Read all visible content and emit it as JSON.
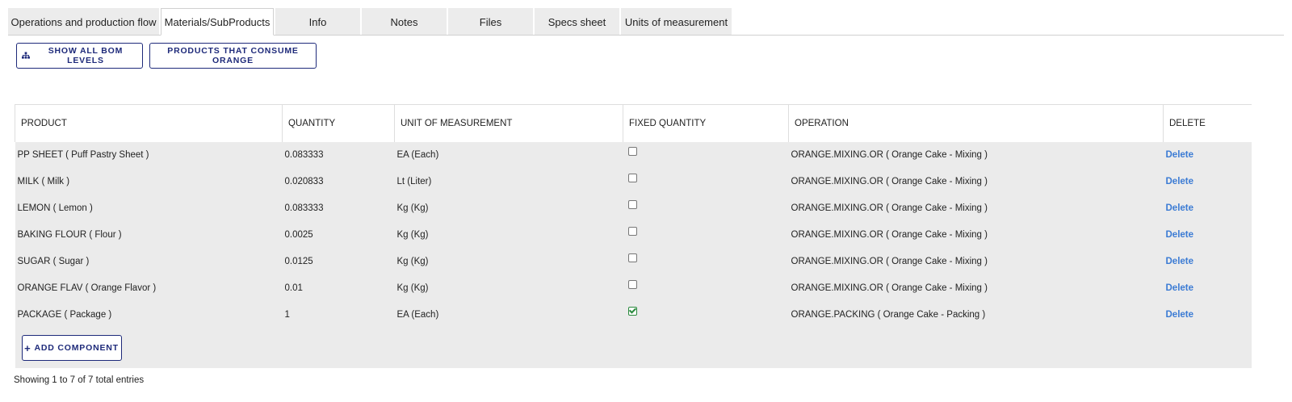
{
  "tabs": [
    {
      "label": "Operations and production flow",
      "active": false
    },
    {
      "label": "Materials/SubProducts",
      "active": true
    },
    {
      "label": "Info",
      "active": false
    },
    {
      "label": "Notes",
      "active": false
    },
    {
      "label": "Files",
      "active": false
    },
    {
      "label": "Specs sheet",
      "active": false
    },
    {
      "label": "Units of measurement",
      "active": false
    }
  ],
  "toolbar": {
    "show_bom_label": "SHOW ALL BOM LEVELS",
    "show_bom_icon": "sitemap-icon",
    "consumers_label": "PRODUCTS THAT CONSUME ORANGE"
  },
  "table": {
    "columns": [
      "PRODUCT",
      "QUANTITY",
      "UNIT OF MEASUREMENT",
      "FIXED QUANTITY",
      "OPERATION",
      "DELETE"
    ],
    "rows": [
      {
        "product": "PP SHEET ( Puff Pastry Sheet )",
        "quantity": "0.083333",
        "unit": "EA (Each)",
        "fixed": false,
        "operation": "ORANGE.MIXING.OR ( Orange Cake - Mixing )",
        "delete": "Delete"
      },
      {
        "product": "MILK ( Milk )",
        "quantity": "0.020833",
        "unit": "Lt (Liter)",
        "fixed": false,
        "operation": "ORANGE.MIXING.OR ( Orange Cake - Mixing )",
        "delete": "Delete"
      },
      {
        "product": "LEMON ( Lemon )",
        "quantity": "0.083333",
        "unit": "Kg (Kg)",
        "fixed": false,
        "operation": "ORANGE.MIXING.OR ( Orange Cake - Mixing )",
        "delete": "Delete"
      },
      {
        "product": "BAKING FLOUR ( Flour )",
        "quantity": "0.0025",
        "unit": "Kg (Kg)",
        "fixed": false,
        "operation": "ORANGE.MIXING.OR ( Orange Cake - Mixing )",
        "delete": "Delete"
      },
      {
        "product": "SUGAR ( Sugar )",
        "quantity": "0.0125",
        "unit": "Kg (Kg)",
        "fixed": false,
        "operation": "ORANGE.MIXING.OR ( Orange Cake - Mixing )",
        "delete": "Delete"
      },
      {
        "product": "ORANGE FLAV ( Orange Flavor )",
        "quantity": "0.01",
        "unit": "Kg (Kg)",
        "fixed": false,
        "operation": "ORANGE.MIXING.OR ( Orange Cake - Mixing )",
        "delete": "Delete"
      },
      {
        "product": "PACKAGE ( Package )",
        "quantity": "1",
        "unit": "EA (Each)",
        "fixed": true,
        "operation": "ORANGE.PACKING ( Orange Cake - Packing )",
        "delete": "Delete"
      }
    ],
    "add_label": "ADD COMPONENT"
  },
  "info": "Showing 1 to 7 of 7 total entries",
  "colors": {
    "accent": "#1e2a7a",
    "link": "#3b7bd4",
    "check": "#2b8a3e",
    "row_bg": "#ebebeb"
  }
}
